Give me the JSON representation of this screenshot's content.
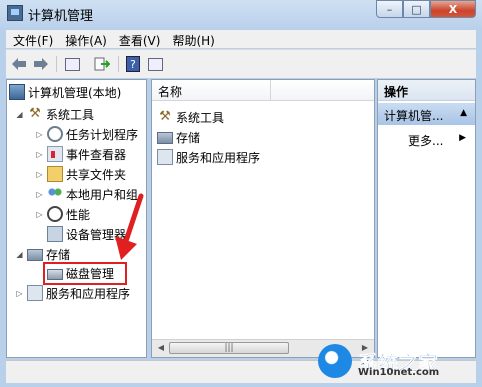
{
  "window": {
    "title": "计算机管理"
  },
  "title_buttons": {
    "minimize": "–",
    "maximize": "□",
    "close": "X"
  },
  "menu": [
    "文件(F)",
    "操作(A)",
    "查看(V)",
    "帮助(H)"
  ],
  "tree": {
    "root": "计算机管理(本地)",
    "system_tools": "系统工具",
    "task_scheduler": "任务计划程序",
    "event_viewer": "事件查看器",
    "shared_folders": "共享文件夹",
    "local_users": "本地用户和组",
    "performance": "性能",
    "device_manager": "设备管理器",
    "storage": "存储",
    "disk_management": "磁盘管理",
    "services_apps": "服务和应用程序"
  },
  "list": {
    "column_name": "名称",
    "items": [
      "系统工具",
      "存储",
      "服务和应用程序"
    ]
  },
  "actions": {
    "header": "操作",
    "section": "计算机管...",
    "more": "更多..."
  },
  "watermark": {
    "text": "系统之家",
    "sub": "Win10net.com"
  },
  "colors": {
    "highlight": "#e02020",
    "accent": "#1a5fb4"
  }
}
